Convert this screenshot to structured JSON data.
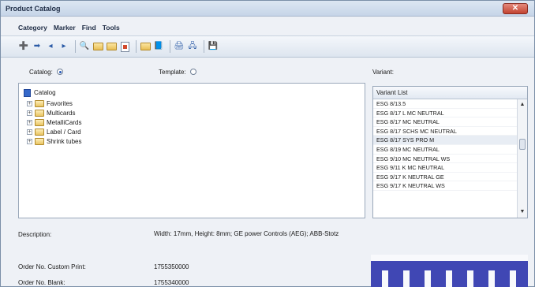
{
  "window": {
    "title": "Product Catalog",
    "close_label": "✕"
  },
  "menu": [
    "Category",
    "Marker",
    "Find",
    "Tools"
  ],
  "toolbar": {
    "buttons": [
      "new-record",
      "move",
      "back",
      "forward",
      "find",
      "open-folder",
      "open-folder-2",
      "print-preview",
      "folder",
      "catalog-book",
      "print",
      "network",
      "save"
    ]
  },
  "labels": {
    "catalog": "Catalog:",
    "template": "Template:",
    "variant": "Variant:"
  },
  "radios": {
    "catalog_selected": true,
    "template_selected": false
  },
  "tree": {
    "root": "Catalog",
    "children": [
      "Favorites",
      "Multicards",
      "MetalliCards",
      "Label / Card",
      "Shrink tubes"
    ]
  },
  "variant_list": {
    "header": "Variant List",
    "items": [
      "ESG 8/13.5",
      "ESG 8/17 L MC NEUTRAL",
      "ESG 8/17 MC NEUTRAL",
      "ESG 8/17 SCHS MC NEUTRAL",
      "ESG 8/17 SYS PRO M",
      "ESG 8/19 MC NEUTRAL",
      "ESG 9/10 MC NEUTRAL WS",
      "ESG 9/11 K MC NEUTRAL",
      "ESG 9/17 K NEUTRAL GE",
      "ESG 9/17 K NEUTRAL WS"
    ],
    "selected_index": 4
  },
  "details": {
    "description_label": "Description:",
    "description_value": "Width: 17mm, Height: 8mm; GE power Controls (AEG); ABB-Stotz",
    "order_custom_label": "Order No. Custom Print:",
    "order_custom_value": "1755350000",
    "order_blank_label": "Order No. Blank:",
    "order_blank_value": "1755340000"
  },
  "colors": {
    "accent": "#2458b8",
    "preview_blue": "#4047b4",
    "close_red": "#c24331"
  }
}
